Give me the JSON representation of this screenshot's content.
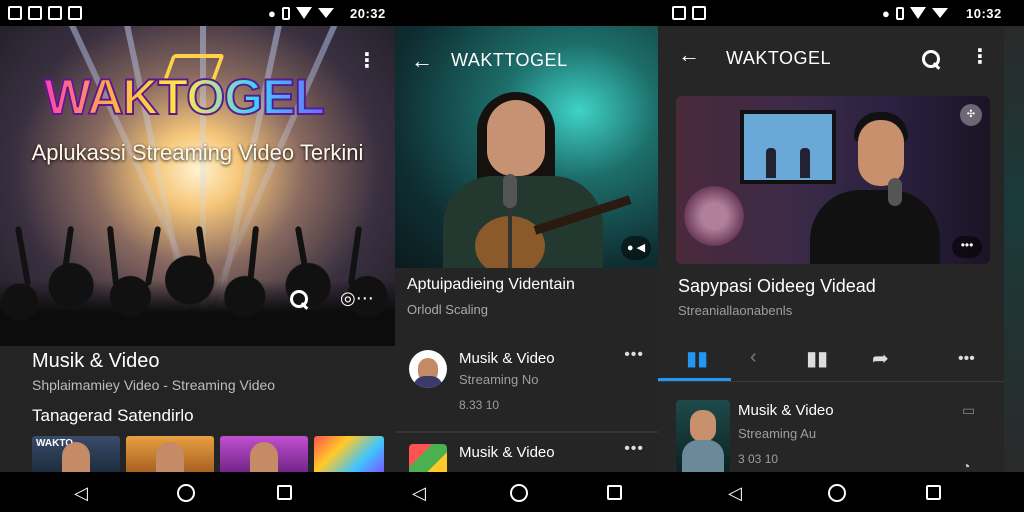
{
  "status_bar": {
    "time_left": "20:32",
    "time_right": "10:32"
  },
  "panel1": {
    "brand": "WAKTOGEL",
    "tagline": "Aplukassi Streaming Video Terkini",
    "section_title": "Musik & Video",
    "section_subtitle": "Shplaimamiey Video - Streaming Video",
    "row_title": "Tanagerad Satendirlo",
    "thumb_label": "WAKTO"
  },
  "panel2": {
    "brand": "WAKTTOGEL",
    "badge": "● ◀",
    "video_title": "Aptuipadieing Videntain",
    "video_meta": "Orlodl Scaling",
    "items": [
      {
        "title": "Musik & Video",
        "subtitle": "Streaming No",
        "stat": "8.33 10",
        "more": "•••"
      },
      {
        "title": "Musik & Video",
        "subtitle": "",
        "stat": "",
        "more": "•••"
      }
    ]
  },
  "panel3": {
    "brand": "WAKTOGEL",
    "video_title": "Sapypasi Oideeg Videad",
    "video_subtitle": "Streaniallaonabenls",
    "hero_top_icon": "✣",
    "hero_more": "•••",
    "actions_more": "•••",
    "item": {
      "title": "Musik & Video",
      "subtitle": "Streaming Au",
      "stat": "3 03 10"
    }
  },
  "colors": {
    "accent": "#2196f3",
    "background": "#222222",
    "navbar": "#000000"
  },
  "icons": [
    "more-vert-icon",
    "search-icon",
    "cast-icon",
    "back-arrow-icon",
    "like-icon",
    "dislike-icon",
    "save-icon",
    "share-icon",
    "nav-back-icon",
    "nav-home-icon",
    "nav-recents-icon"
  ]
}
